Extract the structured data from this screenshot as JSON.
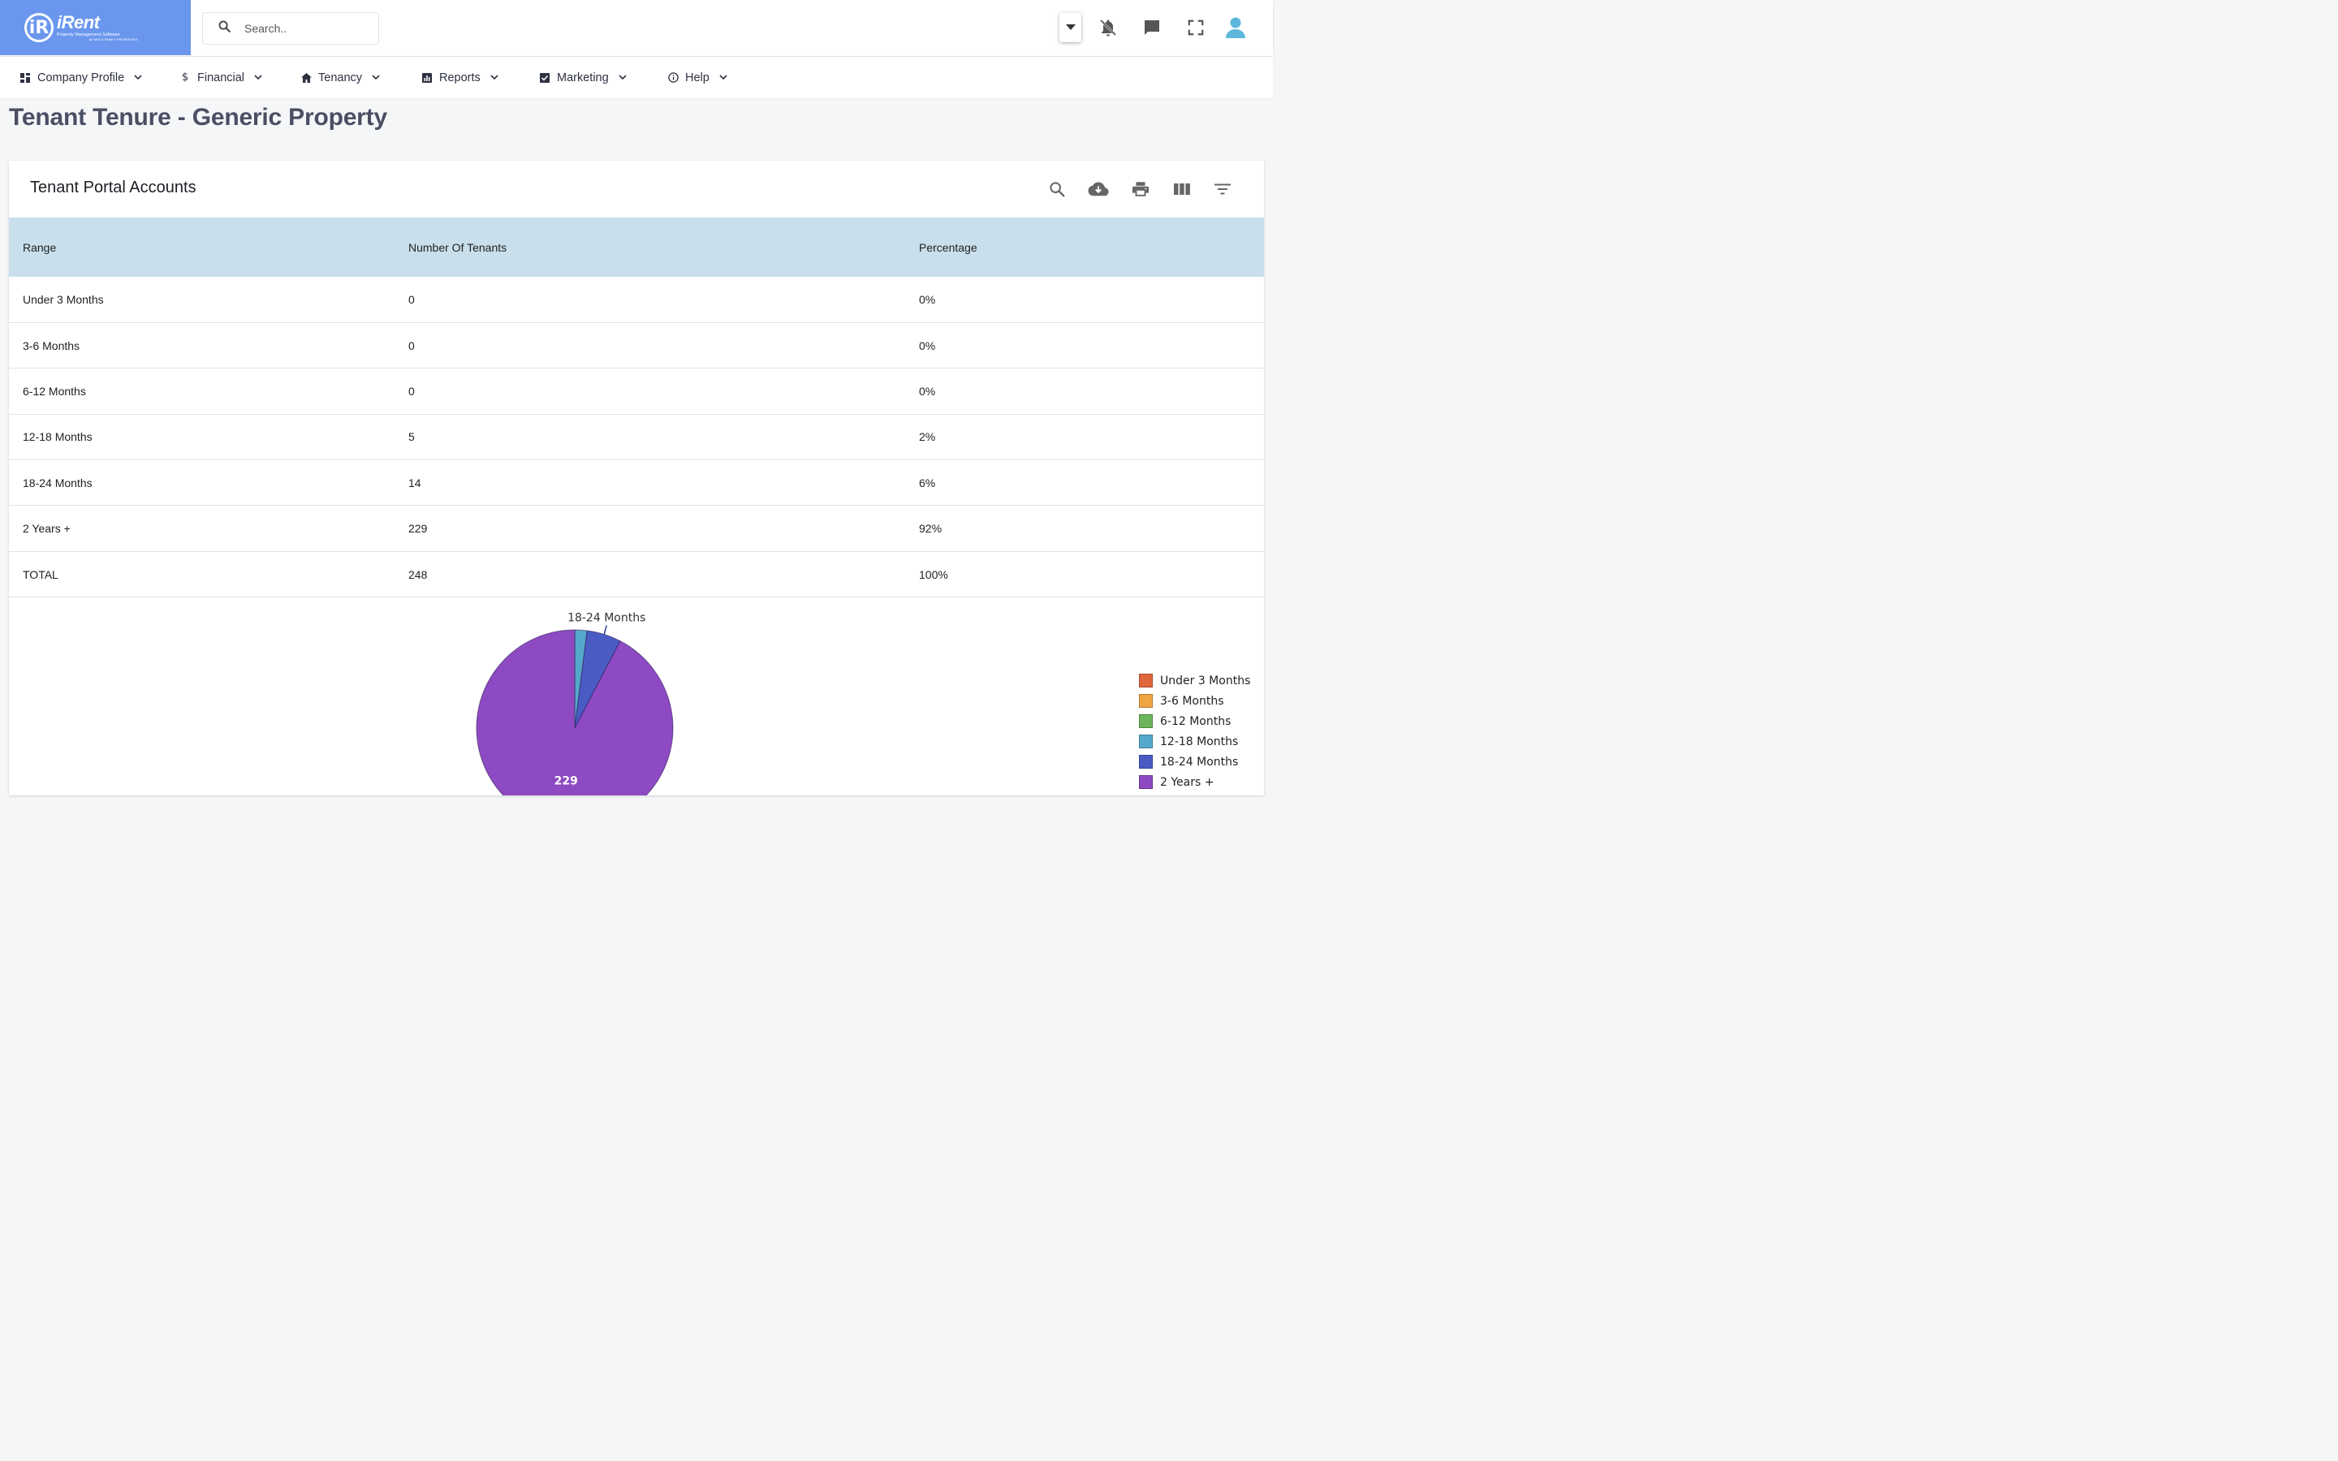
{
  "brand": {
    "name": "iRent",
    "mark": "iR",
    "tagline": "Property Management Software",
    "tagline2": "for MULTI-FAMILY PROPERTIES"
  },
  "search": {
    "placeholder": "Search.."
  },
  "nav": [
    {
      "label": "Company Profile",
      "icon": "dashboard-icon"
    },
    {
      "label": "Financial",
      "icon": "dollar-icon"
    },
    {
      "label": "Tenancy",
      "icon": "home-icon"
    },
    {
      "label": "Reports",
      "icon": "chart-icon"
    },
    {
      "label": "Marketing",
      "icon": "checkbox-icon"
    },
    {
      "label": "Help",
      "icon": "info-icon"
    }
  ],
  "page": {
    "title": "Tenant Tenure - Generic Property"
  },
  "card": {
    "title": "Tenant Portal Accounts"
  },
  "table": {
    "headers": [
      "Range",
      "Number Of Tenants",
      "Percentage"
    ],
    "rows": [
      [
        "Under 3 Months",
        "0",
        "0%"
      ],
      [
        "3-6 Months",
        "0",
        "0%"
      ],
      [
        "6-12 Months",
        "0",
        "0%"
      ],
      [
        "12-18 Months",
        "5",
        "2%"
      ],
      [
        "18-24 Months",
        "14",
        "6%"
      ],
      [
        "2 Years +",
        "229",
        "92%"
      ],
      [
        "TOTAL",
        "248",
        "100%"
      ]
    ]
  },
  "colors": {
    "logo_bg": "#6a96ee",
    "header_row": "#c9e0ec",
    "user_icon": "#5db7dc"
  },
  "chart_data": {
    "type": "pie",
    "categories": [
      "Under 3 Months",
      "3-6 Months",
      "6-12 Months",
      "12-18 Months",
      "18-24 Months",
      "2 Years +"
    ],
    "values": [
      0,
      0,
      0,
      5,
      14,
      229
    ],
    "colors": [
      "#e0663c",
      "#f0a543",
      "#6cb55a",
      "#55a8c9",
      "#4a5cc4",
      "#8e4ac2"
    ],
    "annotations": [
      "18-24 Months",
      "229"
    ],
    "legend": "right"
  }
}
